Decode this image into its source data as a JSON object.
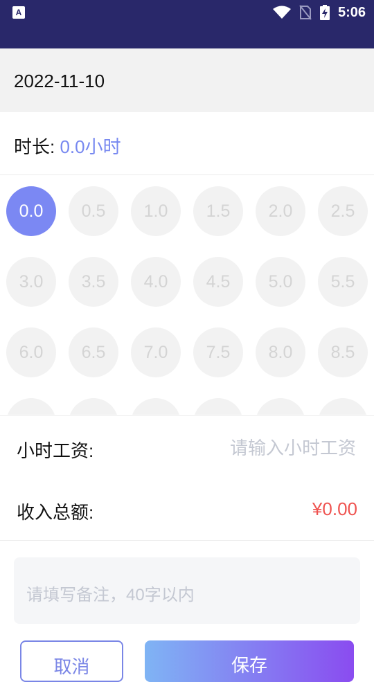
{
  "status_bar": {
    "app_badge": "A",
    "time": "5:06"
  },
  "date": "2022-11-10",
  "duration": {
    "label": "时长: ",
    "value": "0.0小时"
  },
  "hour_options": [
    "0.0",
    "0.5",
    "1.0",
    "1.5",
    "2.0",
    "2.5",
    "3.0",
    "3.5",
    "4.0",
    "4.5",
    "5.0",
    "5.5",
    "6.0",
    "6.5",
    "7.0",
    "7.5",
    "8.0",
    "8.5"
  ],
  "selected_hour": "0.0",
  "hourly_wage": {
    "label": "小时工资:",
    "placeholder": "请输入小时工资",
    "value": ""
  },
  "total_income": {
    "label": "收入总额:",
    "value": "¥0.00"
  },
  "note": {
    "placeholder": "请填写备注，40字以内"
  },
  "buttons": {
    "cancel": "取消",
    "save": "保存"
  },
  "colors": {
    "status_bar": "#29286a",
    "accent": "#7b88f3",
    "amount": "#ef5350"
  }
}
